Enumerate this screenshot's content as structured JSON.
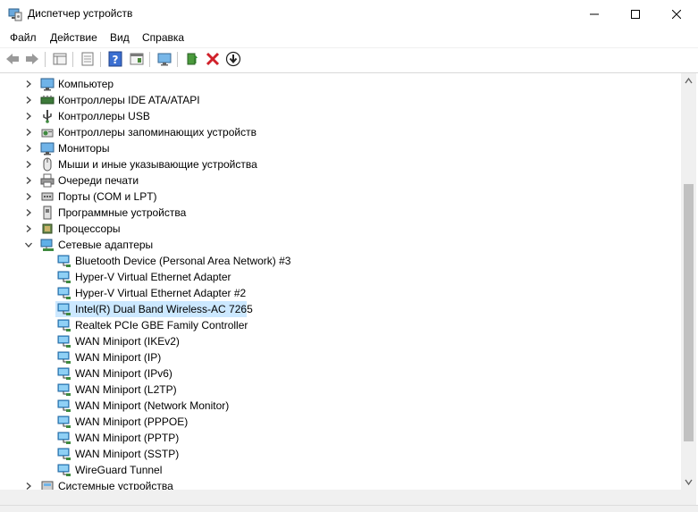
{
  "window": {
    "title": "Диспетчер устройств"
  },
  "menu": [
    "Файл",
    "Действие",
    "Вид",
    "Справка"
  ],
  "toolbar_icons": [
    "back-arrow-icon",
    "forward-arrow-icon",
    "properties-grid-icon",
    "properties-icon",
    "help-icon",
    "action-panel-icon",
    "monitor-scan-icon",
    "update-driver-icon",
    "uninstall-x-icon",
    "download-driver-icon"
  ],
  "tree": {
    "categories_above": [
      {
        "label": "Компьютер",
        "icon": "computer-icon"
      },
      {
        "label": "Контроллеры IDE ATA/ATAPI",
        "icon": "ide-controller-icon"
      },
      {
        "label": "Контроллеры USB",
        "icon": "usb-icon"
      },
      {
        "label": "Контроллеры запоминающих устройств",
        "icon": "storage-controller-icon"
      },
      {
        "label": "Мониторы",
        "icon": "monitor-icon"
      },
      {
        "label": "Мыши и иные указывающие устройства",
        "icon": "mouse-icon"
      },
      {
        "label": "Очереди печати",
        "icon": "printer-icon"
      },
      {
        "label": "Порты (COM и LPT)",
        "icon": "port-icon"
      },
      {
        "label": "Программные устройства",
        "icon": "software-device-icon"
      },
      {
        "label": "Процессоры",
        "icon": "processor-icon"
      }
    ],
    "expanded_category": {
      "label": "Сетевые адаптеры",
      "icon": "network-adapters-icon"
    },
    "network_adapters": [
      "Bluetooth Device (Personal Area Network) #3",
      "Hyper-V Virtual Ethernet Adapter",
      "Hyper-V Virtual Ethernet Adapter #2",
      "Intel(R) Dual Band Wireless-AC 7265",
      "Realtek PCIe GBE Family Controller",
      "WAN Miniport (IKEv2)",
      "WAN Miniport (IP)",
      "WAN Miniport (IPv6)",
      "WAN Miniport (L2TP)",
      "WAN Miniport (Network Monitor)",
      "WAN Miniport (PPPOE)",
      "WAN Miniport (PPTP)",
      "WAN Miniport (SSTP)",
      "WireGuard Tunnel"
    ],
    "selected_adapter": "Intel(R) Dual Band Wireless-AC 7265",
    "categories_below": [
      {
        "label": "Системные устройства",
        "icon": "system-devices-icon"
      }
    ]
  },
  "colors": {
    "selection": "#cce8ff",
    "adapter_icon": "#2f8fd6",
    "delete": "#d0202a"
  }
}
